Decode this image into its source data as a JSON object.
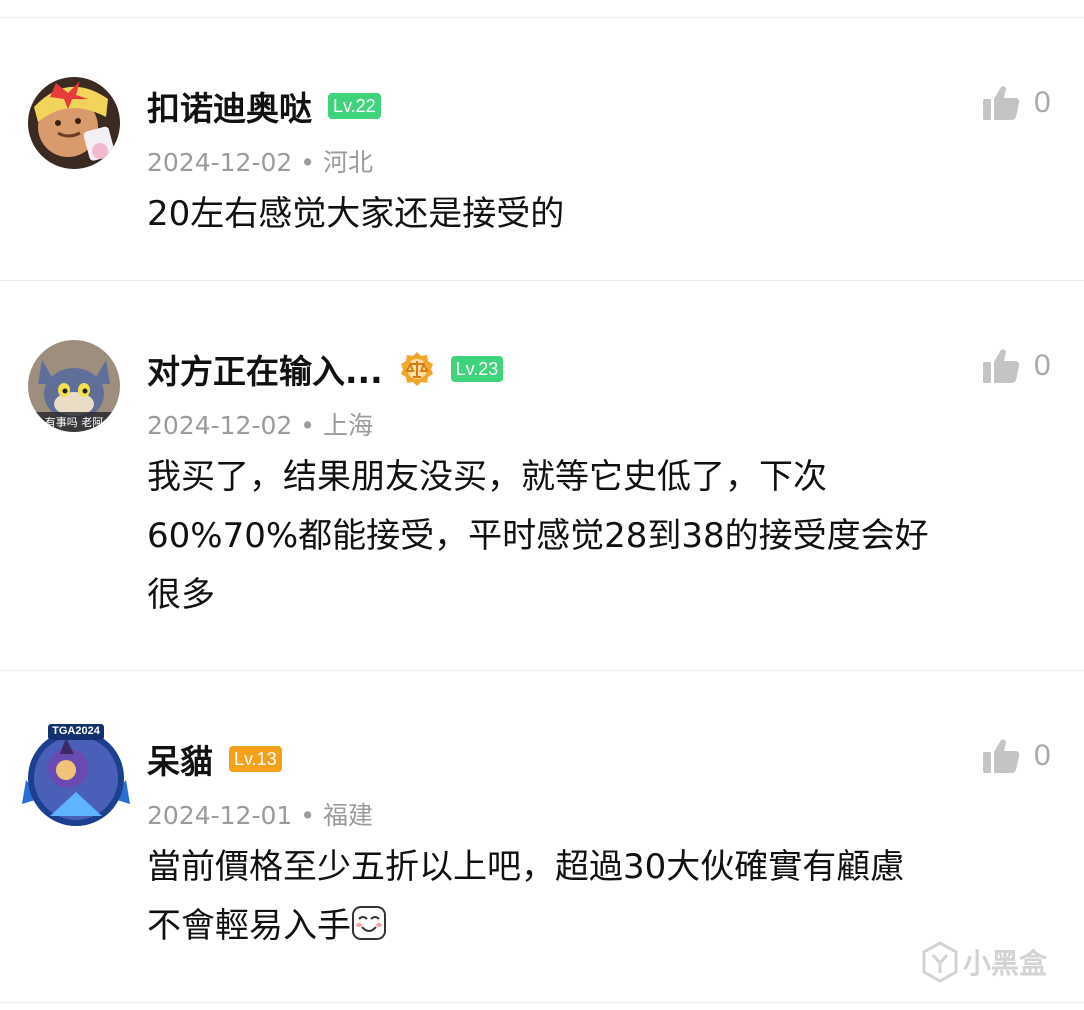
{
  "comments": [
    {
      "username": "扣诺迪奥哒",
      "level": "Lv.22",
      "level_color": "#3fd37b",
      "date": "2024-12-02",
      "separator": "•",
      "location": "河北",
      "likes": "0",
      "text": "20左右感觉大家还是接受的"
    },
    {
      "username": "对方正在输入...",
      "level": "Lv.23",
      "level_color": "#3fd37b",
      "medal": "scales-medal-icon",
      "date": "2024-12-02",
      "separator": "•",
      "location": "上海",
      "likes": "0",
      "avatar_caption": "有事吗 老阿",
      "text_lines": [
        "我买了，结果朋友没买，就等它史低了，下次",
        "60%70%都能接受，平时感觉28到38的接受度会好",
        "很多"
      ]
    },
    {
      "username": "呆貓",
      "level": "Lv.13",
      "level_color": "#f5a11c",
      "date": "2024-12-01",
      "separator": "•",
      "location": "福建",
      "likes": "0",
      "avatar_caption": "TGA2024",
      "text_lines": [
        "當前價格至少五折以上吧，超過30大伙確實有顧慮",
        "不會輕易入手"
      ],
      "emoji": "smile-blush-emoji"
    }
  ],
  "watermark": "小黑盒"
}
